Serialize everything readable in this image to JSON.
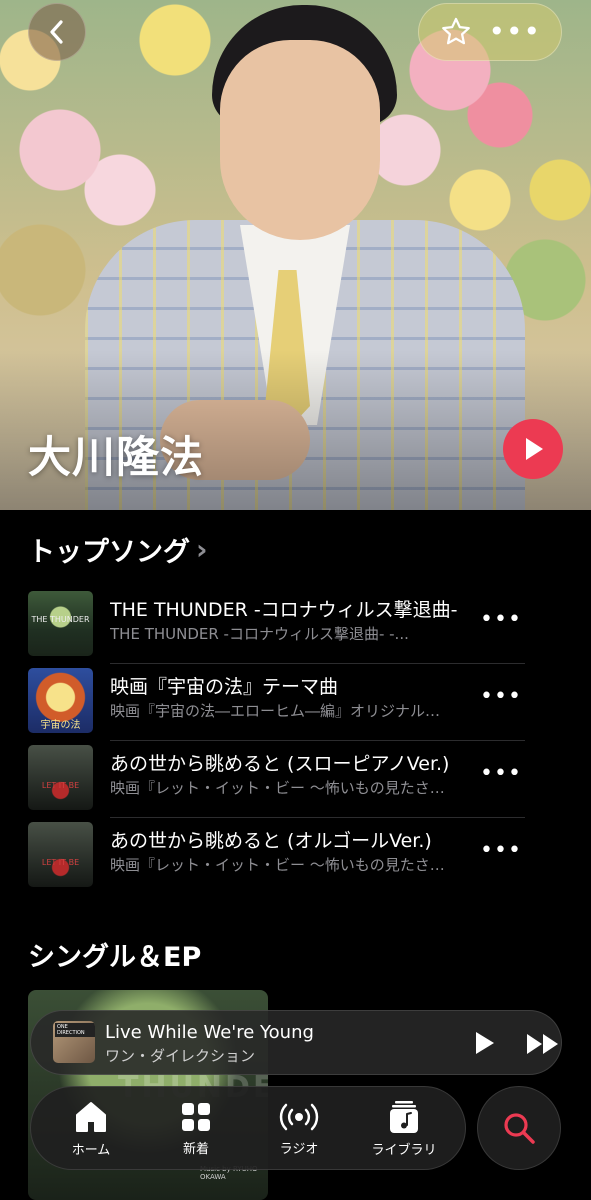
{
  "artist": {
    "name": "大川隆法"
  },
  "top_songs": {
    "heading": "トップソング",
    "items": [
      {
        "title": "THE THUNDER -コロナウィルス撃退曲-",
        "subtitle": "THE THUNDER -コロナウィルス撃退曲- -...",
        "art_text": "THE THUNDER"
      },
      {
        "title": "映画『宇宙の法』テーマ曲",
        "subtitle": "映画『宇宙の法―エローヒム―編』オリジナルサウンドトラック",
        "art_text": "宇宙の法"
      },
      {
        "title": "あの世から眺めると (スローピアノVer.)",
        "subtitle": "映画『レット・イット・ビー 〜怖いもの見たさ〜』",
        "art_text": "LET IT BE"
      },
      {
        "title": "あの世から眺めると (オルゴールVer.)",
        "subtitle": "映画『レット・イット・ビー 〜怖いもの見たさ〜』",
        "art_text": "LET IT BE"
      }
    ],
    "more_label": "•••"
  },
  "singles": {
    "heading": "シングル＆EP",
    "credit": "Music by RYUHO OKAWA",
    "ghost_text": "THUNDER"
  },
  "now_playing": {
    "title": "Live While We're Young",
    "artist": "ワン・ダイレクション",
    "thumb_tag": "ONE DIRECTION"
  },
  "tabs": {
    "home": "ホーム",
    "new": "新着",
    "radio": "ラジオ",
    "library": "ライブラリ"
  },
  "colors": {
    "accent": "#ec3a52",
    "background": "#000000",
    "secondary_text": "#8e8e93"
  }
}
